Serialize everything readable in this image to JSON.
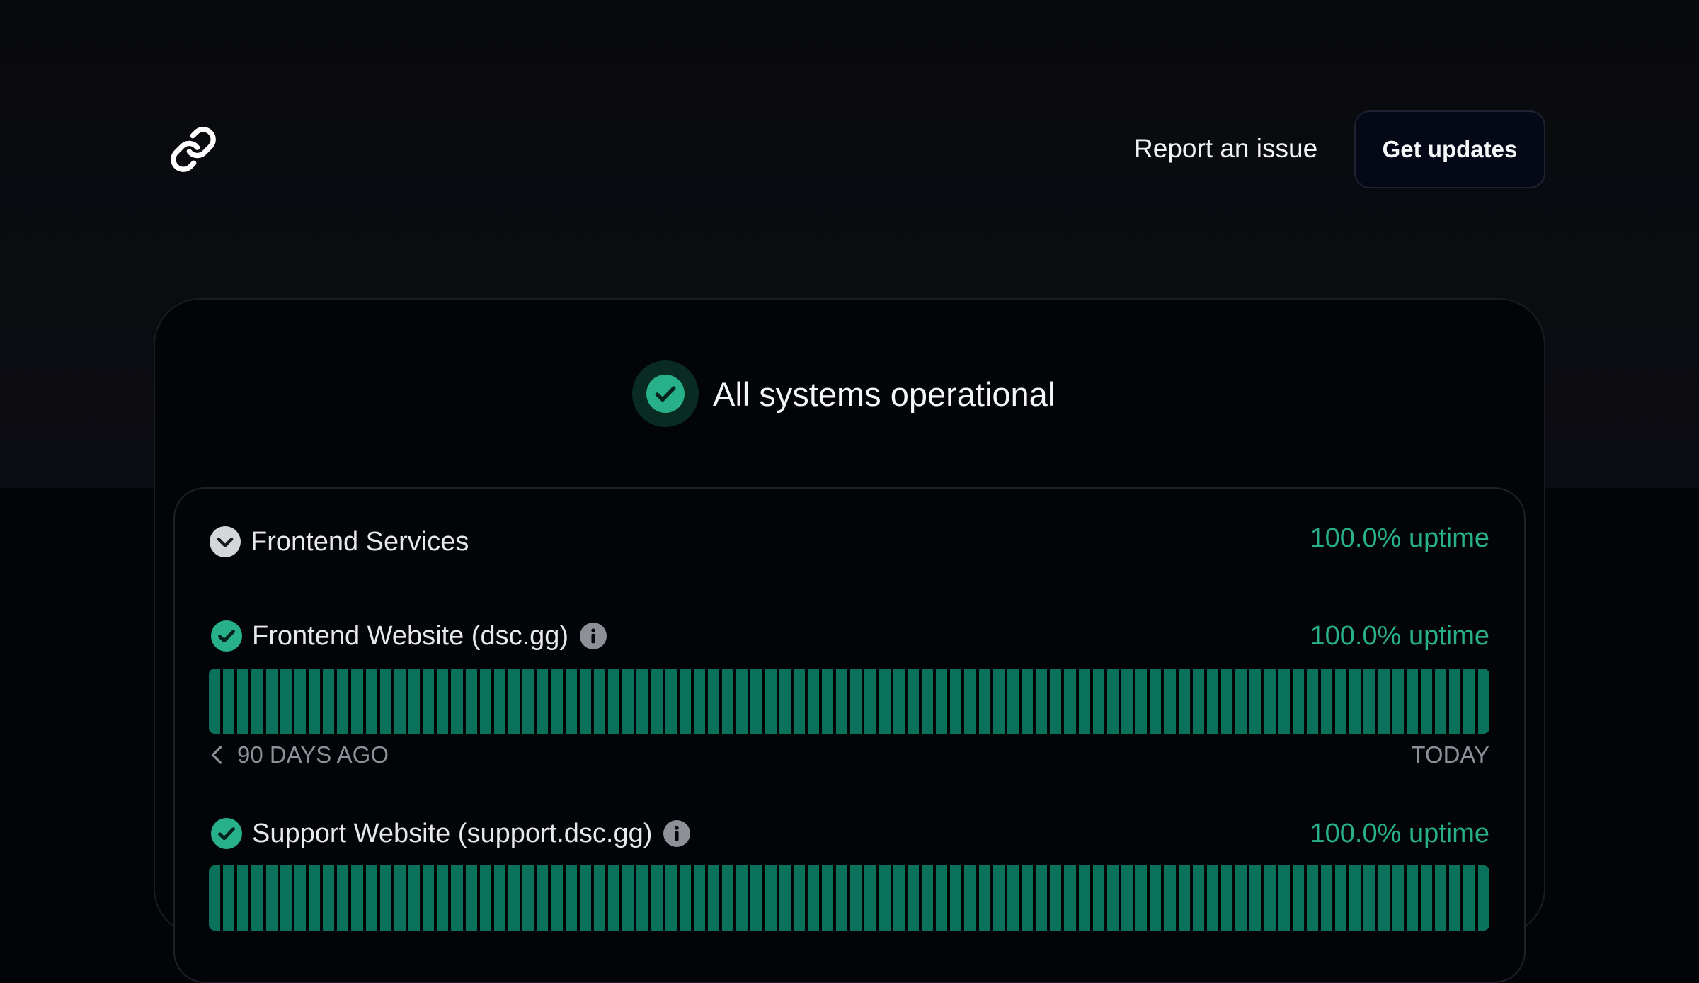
{
  "header": {
    "logo_icon": "chain-link-icon",
    "report_label": "Report an issue",
    "updates_label": "Get updates"
  },
  "overall": {
    "status_text": "All systems operational",
    "icon": "check-circle-icon"
  },
  "group": {
    "name": "Frontend Services",
    "uptime": "100.0% uptime",
    "expand_icon": "chevron-down-icon"
  },
  "services": [
    {
      "name": "Frontend Website (dsc.gg)",
      "uptime": "100.0% uptime",
      "uptime_fraction": 1.0
    },
    {
      "name": "Support Website (support.dsc.gg)",
      "uptime": "100.0% uptime",
      "uptime_fraction": 1.0
    }
  ],
  "range": {
    "start_label": "90 DAYS AGO",
    "end_label": "TODAY"
  },
  "colors": {
    "accent": "#27b089",
    "bar": "#0a715a",
    "background": "#030407"
  }
}
